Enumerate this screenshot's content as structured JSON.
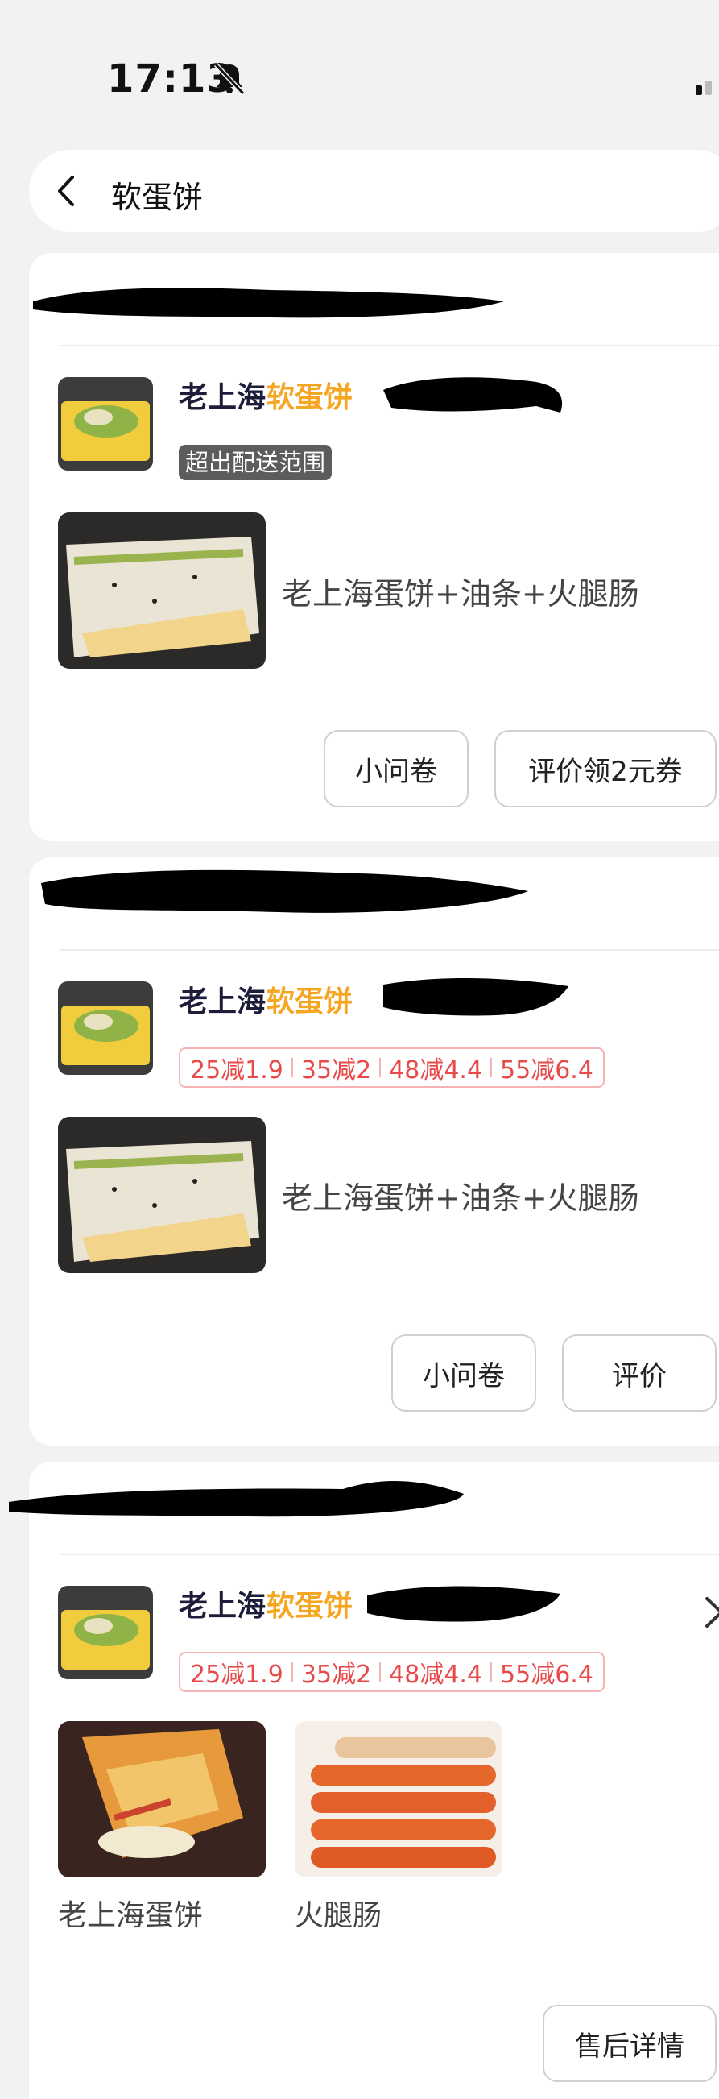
{
  "status_bar": {
    "time": "17:13"
  },
  "search": {
    "query": "软蛋饼"
  },
  "orders": [
    {
      "store_name_prefix": "老上海",
      "store_name_highlight": "软蛋饼",
      "badge": "超出配送范围",
      "item_description": "老上海蛋饼+油条+火腿肠",
      "buttons": [
        "小问卷",
        "评价领2元券"
      ]
    },
    {
      "store_name_prefix": "老上海",
      "store_name_highlight": "软蛋饼",
      "promotions": [
        "25减1.9",
        "35减2",
        "48减4.4",
        "55减6.4"
      ],
      "item_description": "老上海蛋饼+油条+火腿肠",
      "buttons": [
        "小问卷",
        "评价"
      ]
    },
    {
      "store_name_prefix": "老上海",
      "store_name_highlight": "软蛋饼",
      "promotions": [
        "25减1.9",
        "35减2",
        "48减4.4",
        "55减6.4"
      ],
      "items": [
        {
          "name": "老上海蛋饼"
        },
        {
          "name": "火腿肠"
        }
      ],
      "buttons": [
        "售后详情"
      ]
    }
  ],
  "colors": {
    "background": "#f2f2f3",
    "highlight": "#f5a623",
    "promo_red": "#e84a4a",
    "store_name": "#1d1d3a"
  }
}
